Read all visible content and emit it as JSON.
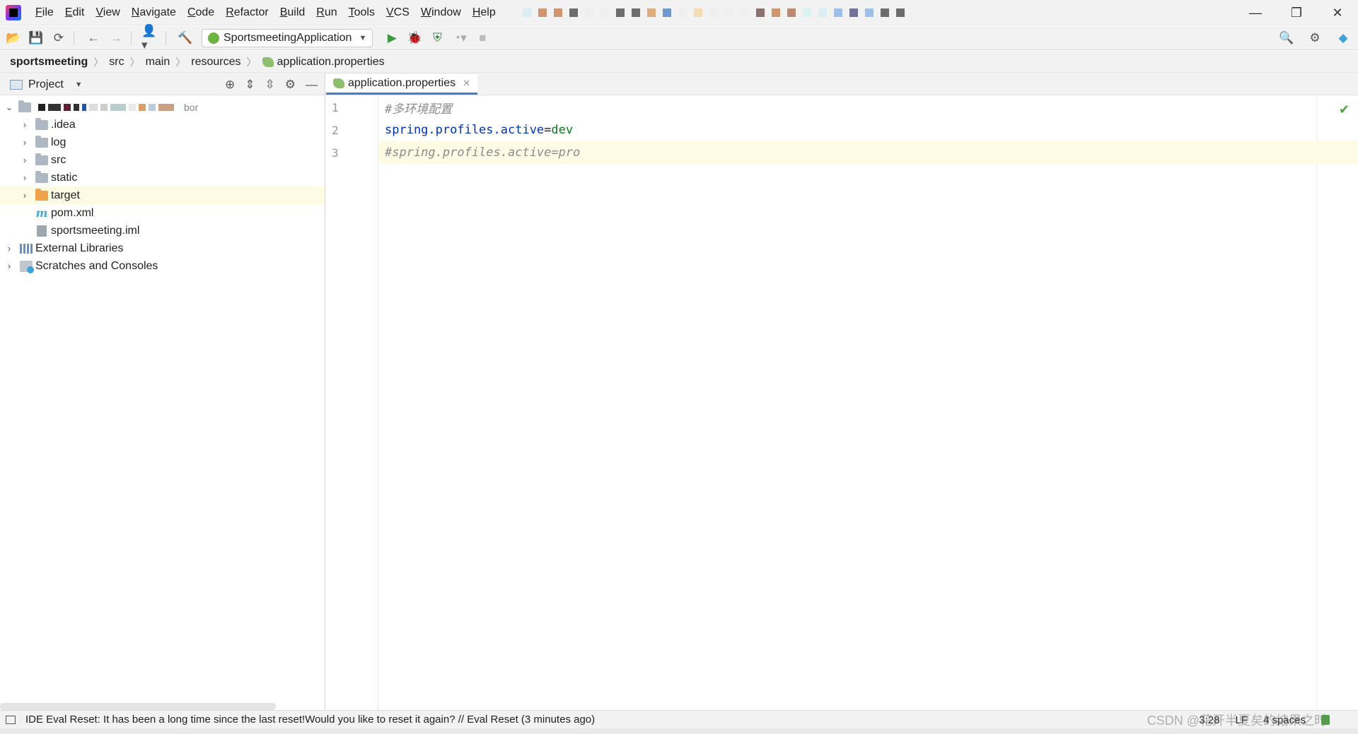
{
  "menu": {
    "items": [
      "File",
      "Edit",
      "View",
      "Navigate",
      "Code",
      "Refactor",
      "Build",
      "Run",
      "Tools",
      "VCS",
      "Window",
      "Help"
    ],
    "mnemonic_first": [
      true,
      true,
      true,
      true,
      true,
      true,
      true,
      true,
      true,
      true,
      true,
      true
    ]
  },
  "window": {
    "minimize": "—",
    "restore": "❐",
    "close": "✕"
  },
  "toolbar": {
    "run_config": "SportsmeetingApplication"
  },
  "breadcrumb": {
    "items": [
      "sportsmeeting",
      "src",
      "main",
      "resources",
      "application.properties"
    ]
  },
  "project_panel": {
    "title": "Project",
    "tree": [
      {
        "label": ".idea",
        "type": "folder"
      },
      {
        "label": "log",
        "type": "folder"
      },
      {
        "label": "src",
        "type": "folder"
      },
      {
        "label": "static",
        "type": "folder"
      },
      {
        "label": "target",
        "type": "folder-excluded"
      },
      {
        "label": "pom.xml",
        "type": "maven"
      },
      {
        "label": "sportsmeeting.iml",
        "type": "iml"
      },
      {
        "label": "External Libraries",
        "type": "libraries"
      },
      {
        "label": "Scratches and Consoles",
        "type": "scratches"
      }
    ],
    "root_suffix": "bor"
  },
  "editor": {
    "tab_label": "application.properties",
    "lines": [
      {
        "number": "1",
        "comment": "#多环境配置"
      },
      {
        "number": "2",
        "key": "spring.profiles.active",
        "eq": "=",
        "value": "dev"
      },
      {
        "number": "3",
        "comment": "#spring.profiles.active=pro"
      }
    ],
    "current_line": 3
  },
  "statusbar": {
    "message": "IDE Eval Reset: It has been a long time since the last reset!Would you like to reset it again? // Eval Reset (3 minutes ago)",
    "position": "3:28",
    "line_sep": "LF",
    "indent": "4 spaces",
    "watermark": "CSDN @花开半夏矣的结果之时"
  },
  "colors": {
    "accent": "#4083c9",
    "keyword": "#0033b3",
    "string_value": "#067d17",
    "comment": "#8c8c8c",
    "current_line": "#fdfbe4"
  }
}
